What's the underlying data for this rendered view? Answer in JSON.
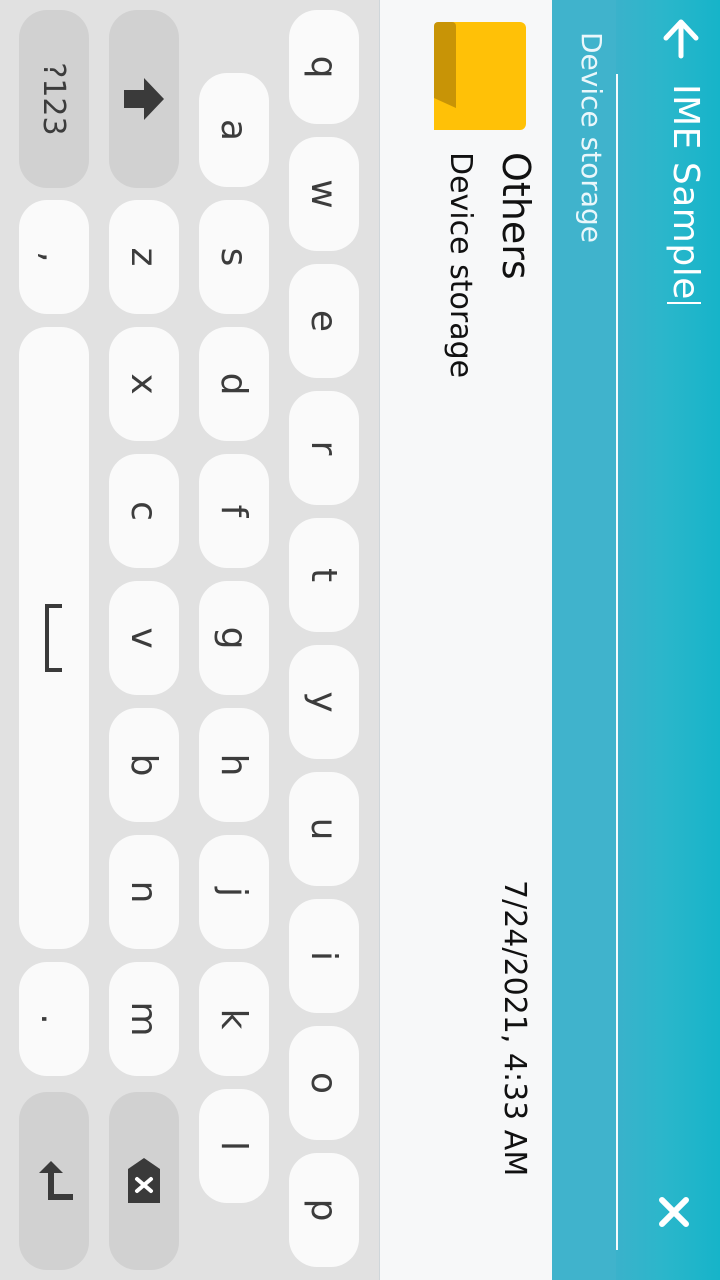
{
  "header": {
    "search_text": "IME Sample",
    "breadcrumb": "Device storage"
  },
  "list": {
    "items": [
      {
        "title": "Others",
        "subtitle": "Device storage",
        "date": "7/24/2021, 4:33 AM"
      }
    ]
  },
  "keyboard": {
    "row1": [
      "q",
      "w",
      "e",
      "r",
      "t",
      "y",
      "u",
      "i",
      "o",
      "p"
    ],
    "row2": [
      "a",
      "s",
      "d",
      "f",
      "g",
      "h",
      "j",
      "k",
      "l"
    ],
    "row3": [
      "z",
      "x",
      "c",
      "v",
      "b",
      "n",
      "m"
    ],
    "mode_label": "?123",
    "comma": ",",
    "period": "."
  },
  "colors": {
    "header": "#16b4c9",
    "folder": "#ffc107",
    "keyboard_bg": "#e1e1e1"
  }
}
